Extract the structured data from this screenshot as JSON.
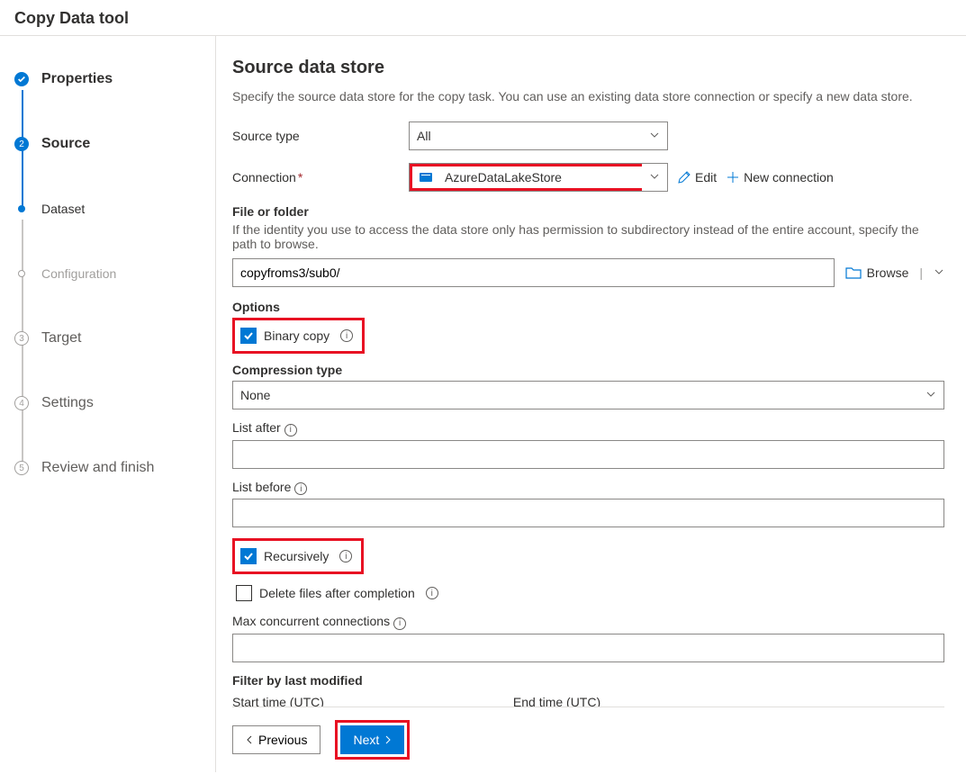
{
  "header": {
    "title": "Copy Data tool"
  },
  "steps": [
    {
      "label": "Properties",
      "state": "done"
    },
    {
      "label": "Source",
      "state": "active"
    },
    {
      "label": "Dataset",
      "state": "sub"
    },
    {
      "label": "Configuration",
      "state": "future"
    },
    {
      "label": "Target",
      "state": "future",
      "num": "3"
    },
    {
      "label": "Settings",
      "state": "future",
      "num": "4"
    },
    {
      "label": "Review and finish",
      "state": "future",
      "num": "5"
    }
  ],
  "page": {
    "title": "Source data store",
    "subtitle": "Specify the source data store for the copy task. You can use an existing data store connection or specify a new data store."
  },
  "source_type": {
    "label": "Source type",
    "value": "All"
  },
  "connection": {
    "label": "Connection",
    "value": "AzureDataLakeStore",
    "edit": "Edit",
    "new": "New connection"
  },
  "file_folder": {
    "label": "File or folder",
    "hint": "If the identity you use to access the data store only has permission to subdirectory instead of the entire account, specify the path to browse.",
    "value": "copyfroms3/sub0/",
    "browse": "Browse"
  },
  "options_label": "Options",
  "binary_copy": {
    "label": "Binary copy",
    "checked": true
  },
  "compression": {
    "label": "Compression type",
    "value": "None"
  },
  "list_after": {
    "label": "List after",
    "value": ""
  },
  "list_before": {
    "label": "List before",
    "value": ""
  },
  "recursively": {
    "label": "Recursively",
    "checked": true
  },
  "delete_after": {
    "label": "Delete files after completion",
    "checked": false
  },
  "max_conn": {
    "label": "Max concurrent connections",
    "value": ""
  },
  "filter": {
    "label": "Filter by last modified",
    "start": "Start time (UTC)",
    "end": "End time (UTC)"
  },
  "footer": {
    "previous": "Previous",
    "next": "Next"
  }
}
